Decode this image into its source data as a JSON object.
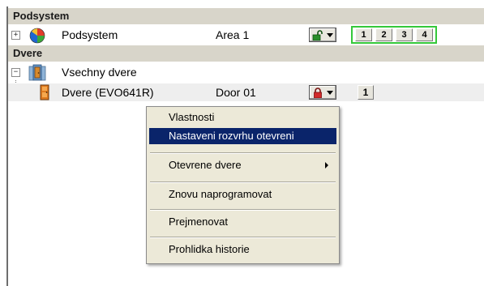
{
  "sections": {
    "subsystem_header": "Podsystem",
    "doors_header": "Dvere"
  },
  "subsystem_row": {
    "expander": "+",
    "name": "Podsystem",
    "area": "Area 1",
    "area_numbers": [
      "1",
      "2",
      "3",
      "4"
    ],
    "lock_state": "unlocked",
    "lock_color": "#2a8f2a"
  },
  "doors_group_row": {
    "expander": "−",
    "name": "Vsechny dvere"
  },
  "door_row": {
    "name": "Dvere (EVO641R)",
    "door": "Door 01",
    "area_number": "1",
    "lock_state": "locked",
    "lock_color": "#d22a2a"
  },
  "context_menu": {
    "items": [
      {
        "label": "Vlastnosti"
      },
      {
        "label": "Nastaveni rozvrhu otevreni",
        "highlighted": true
      },
      {
        "label": "Otevrene dvere",
        "submenu": true
      },
      {
        "label": "Znovu naprogramovat"
      },
      {
        "label": "Prejmenovat"
      },
      {
        "label": "Prohlidka historie"
      }
    ],
    "highlight_color": "#0a246a"
  }
}
